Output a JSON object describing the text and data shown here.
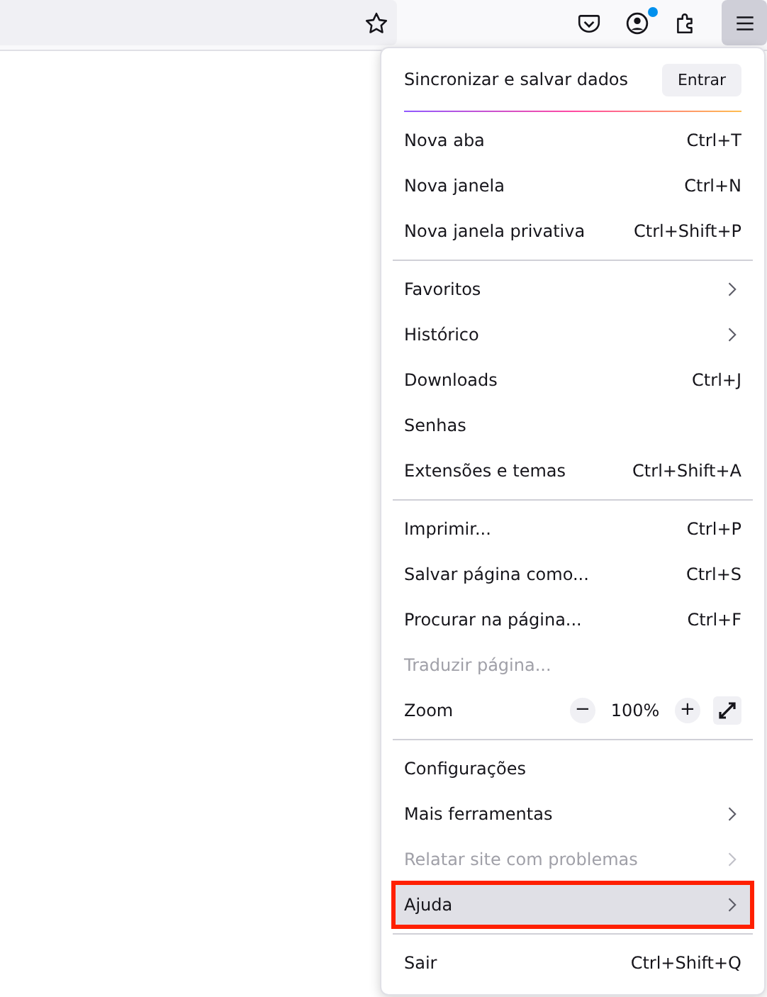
{
  "header": {
    "title": "Sincronizar e salvar dados",
    "button": "Entrar"
  },
  "toolbar": {
    "menu_open": true,
    "account_badge": true
  },
  "sections": [
    [
      {
        "kind": "item",
        "label": "Nova aba",
        "shortcut": "Ctrl+T",
        "disabled": false,
        "highlighted": false
      },
      {
        "kind": "item",
        "label": "Nova janela",
        "shortcut": "Ctrl+N",
        "disabled": false,
        "highlighted": false
      },
      {
        "kind": "item",
        "label": "Nova janela privativa",
        "shortcut": "Ctrl+Shift+P",
        "disabled": false,
        "highlighted": false
      }
    ],
    [
      {
        "kind": "submenu",
        "label": "Favoritos",
        "disabled": false,
        "highlighted": false
      },
      {
        "kind": "submenu",
        "label": "Histórico",
        "disabled": false,
        "highlighted": false
      },
      {
        "kind": "item",
        "label": "Downloads",
        "shortcut": "Ctrl+J",
        "disabled": false,
        "highlighted": false
      },
      {
        "kind": "item",
        "label": "Senhas",
        "disabled": false,
        "highlighted": false
      },
      {
        "kind": "item",
        "label": "Extensões e temas",
        "shortcut": "Ctrl+Shift+A",
        "disabled": false,
        "highlighted": false
      }
    ],
    [
      {
        "kind": "item",
        "label": "Imprimir...",
        "shortcut": "Ctrl+P",
        "disabled": false,
        "highlighted": false
      },
      {
        "kind": "item",
        "label": "Salvar página como...",
        "shortcut": "Ctrl+S",
        "disabled": false,
        "highlighted": false
      },
      {
        "kind": "item",
        "label": "Procurar na página...",
        "shortcut": "Ctrl+F",
        "disabled": false,
        "highlighted": false
      },
      {
        "kind": "item",
        "label": "Traduzir página...",
        "disabled": true,
        "highlighted": false
      },
      {
        "kind": "zoom",
        "label": "Zoom",
        "minus": "−",
        "value": "100%",
        "plus": "+"
      }
    ],
    [
      {
        "kind": "item",
        "label": "Configurações",
        "disabled": false,
        "highlighted": false
      },
      {
        "kind": "submenu",
        "label": "Mais ferramentas",
        "disabled": false,
        "highlighted": false
      },
      {
        "kind": "submenu",
        "label": "Relatar site com problemas",
        "disabled": true,
        "highlighted": false
      },
      {
        "kind": "submenu",
        "label": "Ajuda",
        "disabled": false,
        "highlighted": true
      }
    ],
    [
      {
        "kind": "item",
        "label": "Sair",
        "shortcut": "Ctrl+Shift+Q",
        "disabled": false,
        "highlighted": false
      }
    ]
  ]
}
